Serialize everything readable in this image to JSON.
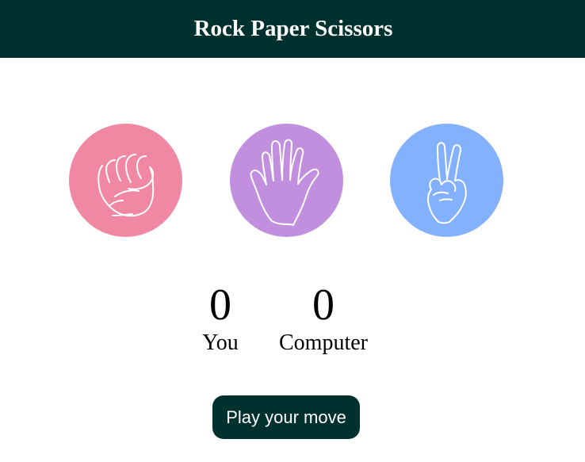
{
  "header": {
    "title": "Rock Paper Scissors",
    "background_color": "#01312f"
  },
  "choices": [
    {
      "id": "rock",
      "icon": "fist-icon",
      "color": "#f087a3"
    },
    {
      "id": "paper",
      "icon": "open-hand-icon",
      "color": "#c18fdd"
    },
    {
      "id": "scissors",
      "icon": "peace-hand-icon",
      "color": "#84b1fd"
    }
  ],
  "scores": {
    "you": {
      "value": "0",
      "label": "You"
    },
    "computer": {
      "value": "0",
      "label": "Computer"
    }
  },
  "play_button": {
    "label": "Play your move",
    "color": "#01312f"
  }
}
